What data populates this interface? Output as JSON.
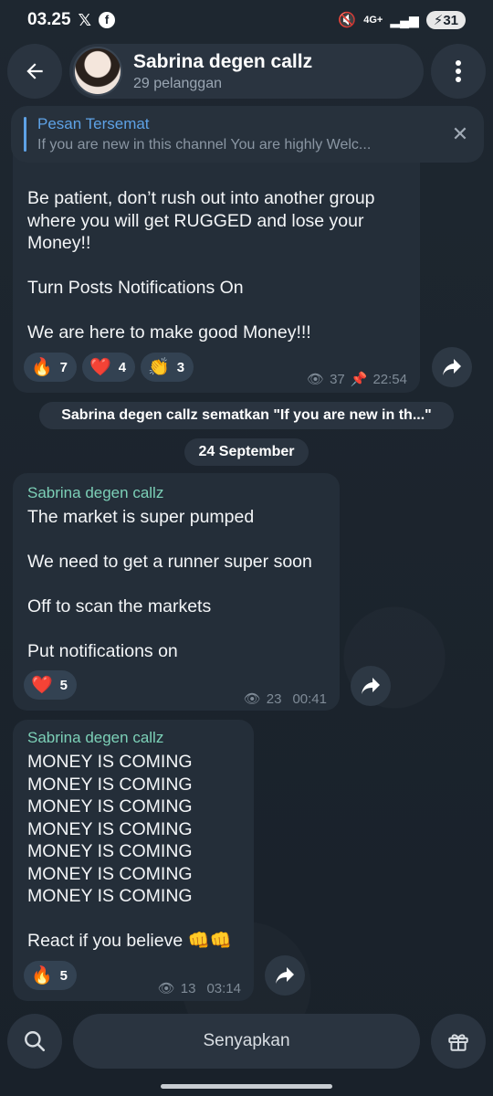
{
  "status_bar": {
    "time": "03.25",
    "network": "4G+",
    "battery": "31"
  },
  "header": {
    "channel_name": "Sabrina degen callz",
    "subscribers": "29 pelanggan"
  },
  "pinned": {
    "title": "Pesan Tersemat",
    "preview": "If you are new in this channel   You are highly Welc..."
  },
  "messages": [
    {
      "text": "Be patient, don’t rush out into another group where you will get RUGGED and lose your Money!!\n\nTurn Posts Notifications On\n\nWe are here to make good Money!!!",
      "reactions": [
        {
          "emoji": "🔥",
          "count": "7"
        },
        {
          "emoji": "❤️",
          "count": "4"
        },
        {
          "emoji": "👏",
          "count": "3"
        }
      ],
      "views": "37",
      "time": "22:54"
    },
    {
      "sender": "Sabrina degen callz",
      "text": "The market is super pumped\n\nWe need to get a runner super soon\n\nOff to scan the markets\n\nPut notifications on",
      "reactions": [
        {
          "emoji": "❤️",
          "count": "5"
        }
      ],
      "views": "23",
      "time": "00:41"
    },
    {
      "sender": "Sabrina degen callz",
      "text": "MONEY IS COMING\nMONEY IS COMING\nMONEY IS COMING\nMONEY IS COMING\nMONEY IS COMING\nMONEY IS COMING\nMONEY IS COMING\n\nReact if you believe 👊👊",
      "reactions": [
        {
          "emoji": "🔥",
          "count": "5"
        }
      ],
      "views": "13",
      "time": "03:14"
    }
  ],
  "service": {
    "pin_notice": "Sabrina degen callz sematkan \"If you are new in th...\"",
    "date_label": "24 September"
  },
  "bottom_bar": {
    "mute_label": "Senyapkan"
  },
  "colors": {
    "accent": "#5ea2e6",
    "sender": "#7cd0b7",
    "bubble": "#242e39",
    "background": "#1b232c"
  }
}
